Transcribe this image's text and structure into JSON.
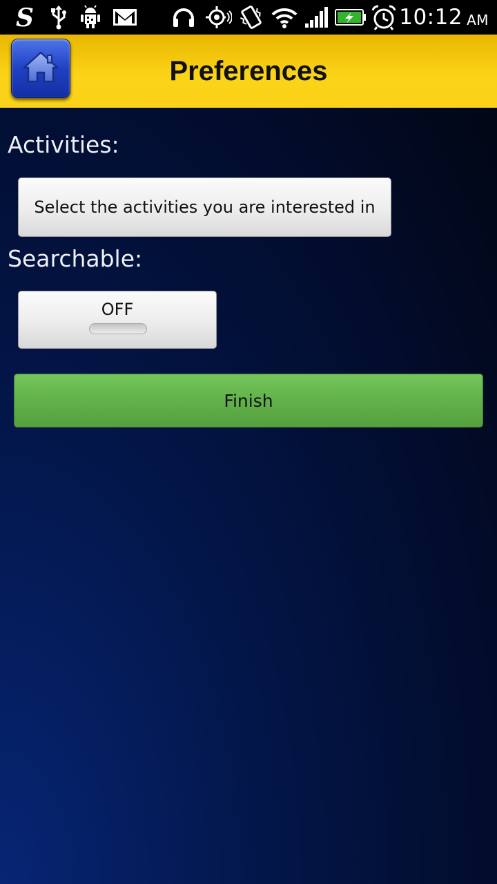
{
  "status_bar": {
    "time": "10:12",
    "ampm": "AM",
    "icons": [
      "swype-s-icon",
      "usb-icon",
      "android-debug-icon",
      "gmail-icon",
      "headset-icon",
      "gps-icon",
      "vibrate-icon",
      "wifi-icon",
      "signal-icon",
      "battery-charging-icon",
      "alarm-icon"
    ]
  },
  "header": {
    "title": "Preferences",
    "home_icon": "home-icon"
  },
  "activities": {
    "label": "Activities:",
    "button_label": "Select the activities you are interested in"
  },
  "searchable": {
    "label": "Searchable:",
    "toggle_state": "OFF"
  },
  "finish": {
    "label": "Finish"
  },
  "colors": {
    "header_bg": "#fbd317",
    "home_button": "#1f41c3",
    "finish_button": "#62b24b",
    "background": "#031649"
  }
}
